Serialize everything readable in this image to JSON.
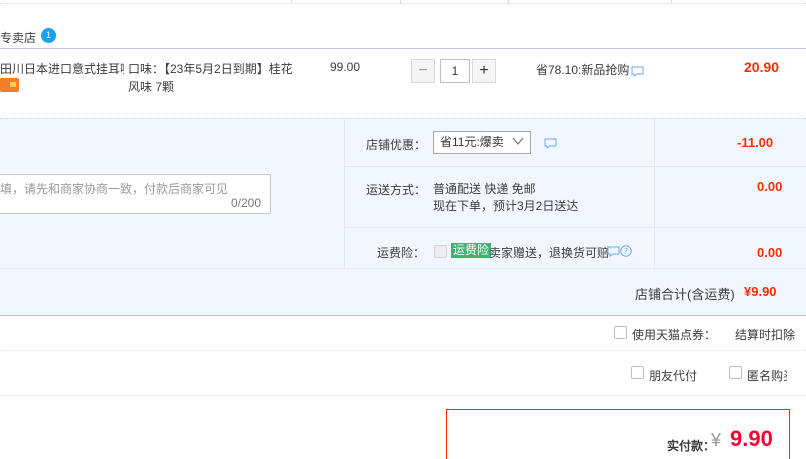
{
  "shop": {
    "name": "专卖店",
    "badge": "1"
  },
  "item": {
    "title": "田川日本进口意式挂耳咖...",
    "sku": "口味：【23年5月2日到期】桂花风味 7颗",
    "price": "99.00",
    "quantity": "1",
    "minus": "−",
    "plus": "+",
    "promo": "省78.10:新品抢购",
    "total": "20.90"
  },
  "memo": {
    "placeholder": "填，请先和商家协商一致，付款后商家可见",
    "count": "0/200"
  },
  "discount": {
    "label": "店铺优惠：",
    "selected": "省11元:爆卖",
    "amount": "-11.00"
  },
  "shipping": {
    "label": "运送方式：",
    "method": "普通配送 快递 免邮",
    "eta": "现在下单，预计3月2日送达",
    "amount": "0.00"
  },
  "insurance": {
    "label": "运费险：",
    "tag": "运费险",
    "text": "卖家赠送，退换货可赔",
    "amount": "0.00"
  },
  "shop_total": {
    "label": "店铺合计(含运费)",
    "value": "¥9.90"
  },
  "tmall_points": {
    "label": "使用天猫点券：",
    "note": "结算时扣除"
  },
  "friend_pay": {
    "label": "朋友代付"
  },
  "anonymous": {
    "label": "匿名购买"
  },
  "payment": {
    "label": "实付款：",
    "currency": "¥",
    "amount": "9.90"
  },
  "colors": {
    "price_red": "#ff2c00",
    "pay_red": "#ff0036",
    "accent_blue": "#1aa0f0",
    "panel_bg": "#f2f7ff"
  }
}
